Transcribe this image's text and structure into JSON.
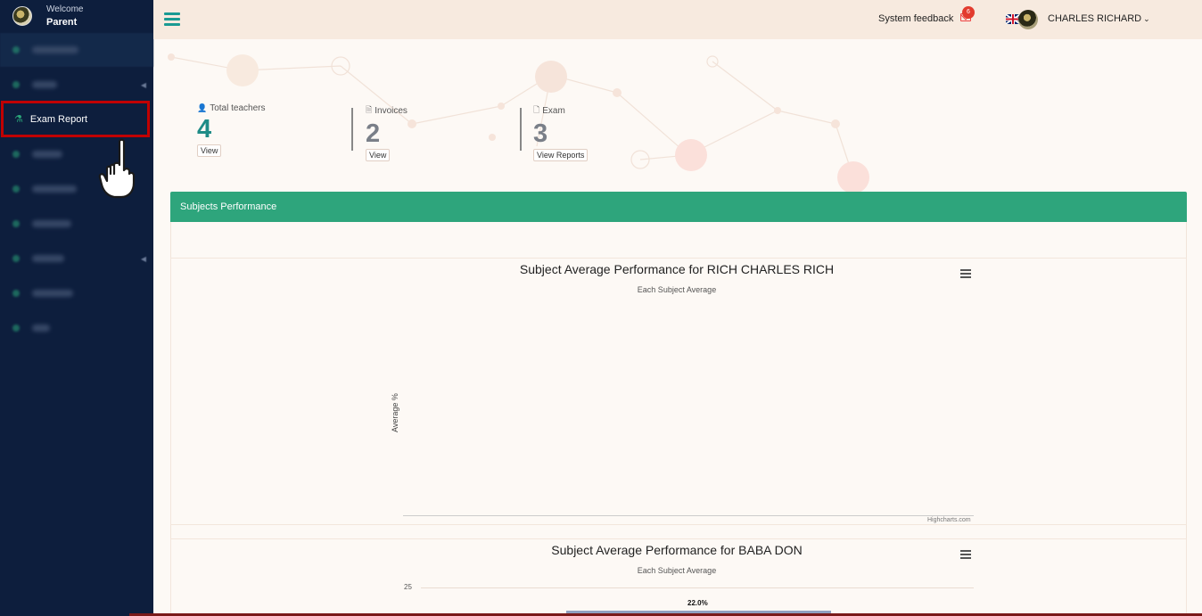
{
  "sidebar": {
    "welcome": "Welcome",
    "role": "Parent",
    "exam_report_label": "Exam Report"
  },
  "topbar": {
    "feedback_label": "System feedback",
    "notification_count": "6",
    "username": "CHARLES RICHARD"
  },
  "stats": [
    {
      "icon": "user-icon",
      "label": "Total teachers",
      "value": "4",
      "button": "View",
      "color": "#1f8c87"
    },
    {
      "icon": "file-icon",
      "label": "Invoices",
      "value": "2",
      "button": "View",
      "color": "#7a7f88"
    },
    {
      "icon": "file-outline-icon",
      "label": "Exam",
      "value": "3",
      "button": "View Reports",
      "color": "#7a7f88"
    }
  ],
  "panel": {
    "title": "Subjects Performance"
  },
  "charts": [
    {
      "title": "Subject Average Performance for RICH CHARLES RICH",
      "subtitle": "Each Subject Average",
      "ylabel": "Average %",
      "credits": "Highcharts.com"
    },
    {
      "title": "Subject Average Performance for BABA DON",
      "subtitle": "Each Subject Average",
      "y_tick": "25",
      "bar_label": "22.0%"
    }
  ],
  "chart_data": [
    {
      "type": "bar",
      "title": "Subject Average Performance for RICH CHARLES RICH",
      "subtitle": "Each Subject Average",
      "ylabel": "Average %",
      "categories": [],
      "values": []
    },
    {
      "type": "bar",
      "title": "Subject Average Performance for BABA DON",
      "subtitle": "Each Subject Average",
      "y_ticks": [
        25
      ],
      "values": [
        22.0
      ],
      "data_labels": [
        "22.0%"
      ]
    }
  ],
  "colors": {
    "sidebar_bg": "#0d1e3d",
    "accent_green": "#2ea57c",
    "highlight_red": "#c00000",
    "teal": "#1f8c87"
  }
}
